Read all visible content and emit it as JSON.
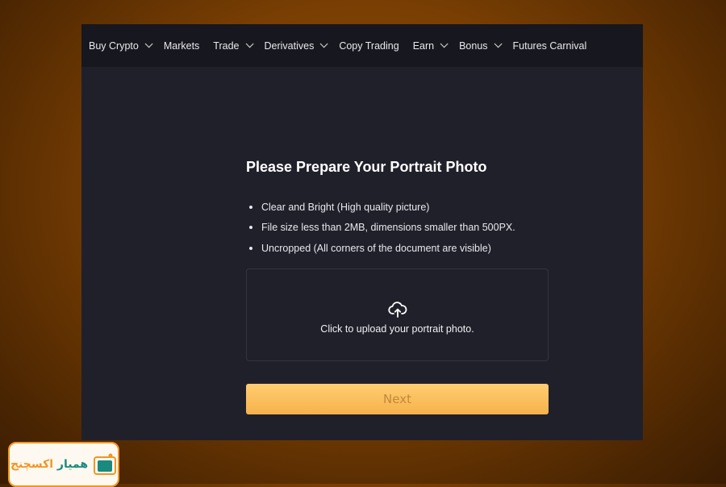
{
  "nav": {
    "items": [
      {
        "label": "Buy Crypto",
        "dropdown": true
      },
      {
        "label": "Markets",
        "dropdown": false
      },
      {
        "label": "Trade",
        "dropdown": true
      },
      {
        "label": "Derivatives",
        "dropdown": true
      },
      {
        "label": "Copy Trading",
        "dropdown": false
      },
      {
        "label": "Earn",
        "dropdown": true
      },
      {
        "label": "Bonus",
        "dropdown": true
      },
      {
        "label": "Futures Carnival",
        "dropdown": false
      }
    ]
  },
  "main": {
    "title": "Please Prepare Your Portrait Photo",
    "requirements": [
      "Clear and Bright (High quality picture)",
      "File size less than 2MB, dimensions smaller than 500PX.",
      "Uncropped (All corners of the document are visible)"
    ],
    "upload": {
      "icon": "cloud-upload-icon",
      "label": "Click to upload your portrait photo."
    },
    "next_label": "Next"
  },
  "watermark": {
    "part1": "همیار",
    "part2": "اکسچنج"
  },
  "colors": {
    "accent": "#f6b24c",
    "nav_bg": "#17171f",
    "page_bg": "#20202b"
  }
}
